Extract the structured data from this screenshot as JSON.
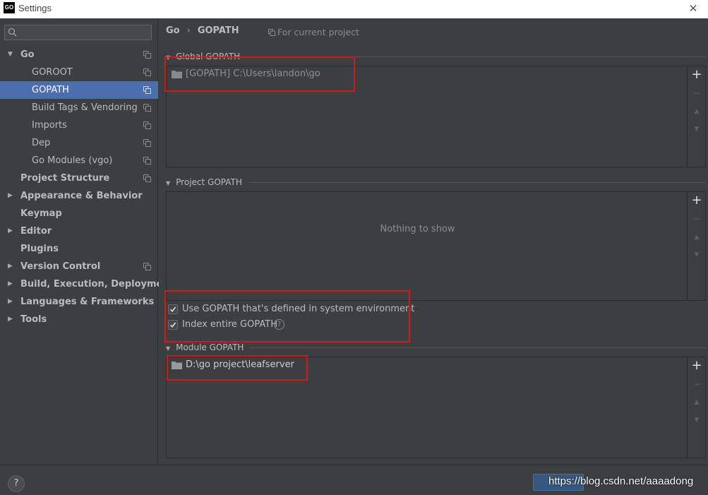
{
  "window": {
    "app_icon": "GO",
    "title": "Settings"
  },
  "sidebar": {
    "search_value": "",
    "items": [
      {
        "label": "Go",
        "has_arrow": true,
        "expanded": true,
        "bold": true,
        "project_icon": true
      },
      {
        "label": "GOROOT",
        "bold": false,
        "project_icon": true
      },
      {
        "label": "GOPATH",
        "bold": false,
        "project_icon": true,
        "selected": true
      },
      {
        "label": "Build Tags & Vendoring",
        "bold": false,
        "project_icon": true
      },
      {
        "label": "Imports",
        "bold": false,
        "project_icon": true
      },
      {
        "label": "Dep",
        "bold": false,
        "project_icon": true
      },
      {
        "label": "Go Modules (vgo)",
        "bold": false,
        "project_icon": true
      },
      {
        "label": "Project Structure",
        "bold": true,
        "project_icon": true
      },
      {
        "label": "Appearance & Behavior",
        "has_arrow": true,
        "bold": true
      },
      {
        "label": "Keymap",
        "bold": true
      },
      {
        "label": "Editor",
        "has_arrow": true,
        "bold": true
      },
      {
        "label": "Plugins",
        "bold": true
      },
      {
        "label": "Version Control",
        "has_arrow": true,
        "bold": true,
        "project_icon": true
      },
      {
        "label": "Build, Execution, Deployment",
        "has_arrow": true,
        "bold": true
      },
      {
        "label": "Languages & Frameworks",
        "has_arrow": true,
        "bold": true
      },
      {
        "label": "Tools",
        "has_arrow": true,
        "bold": true
      }
    ]
  },
  "main": {
    "breadcrumb": {
      "parent": "Go",
      "separator": "›",
      "current": "GOPATH"
    },
    "for_current_project": "For current project",
    "global_gopath": {
      "title": "Global GOPATH",
      "entries": [
        "[GOPATH] C:\\Users\\landon\\go"
      ]
    },
    "project_gopath": {
      "title": "Project GOPATH",
      "empty_text": "Nothing to show"
    },
    "options": {
      "use_system_gopath": {
        "label": "Use GOPATH that's defined in system environment",
        "checked": true
      },
      "index_entire_gopath": {
        "label": "Index entire GOPATH",
        "checked": true
      }
    },
    "module_gopath": {
      "title": "Module GOPATH",
      "entries": [
        "D:\\go project\\leafserver"
      ]
    },
    "tools": {
      "add": "+",
      "remove": "−",
      "up": "▲",
      "down": "▼"
    }
  },
  "footer": {
    "help": "?",
    "watermark": "https://blog.csdn.net/aaaadong"
  },
  "colors": {
    "background": "#3c3f41",
    "selection": "#4b6eaf",
    "annotation_red": "#d11a1a"
  }
}
